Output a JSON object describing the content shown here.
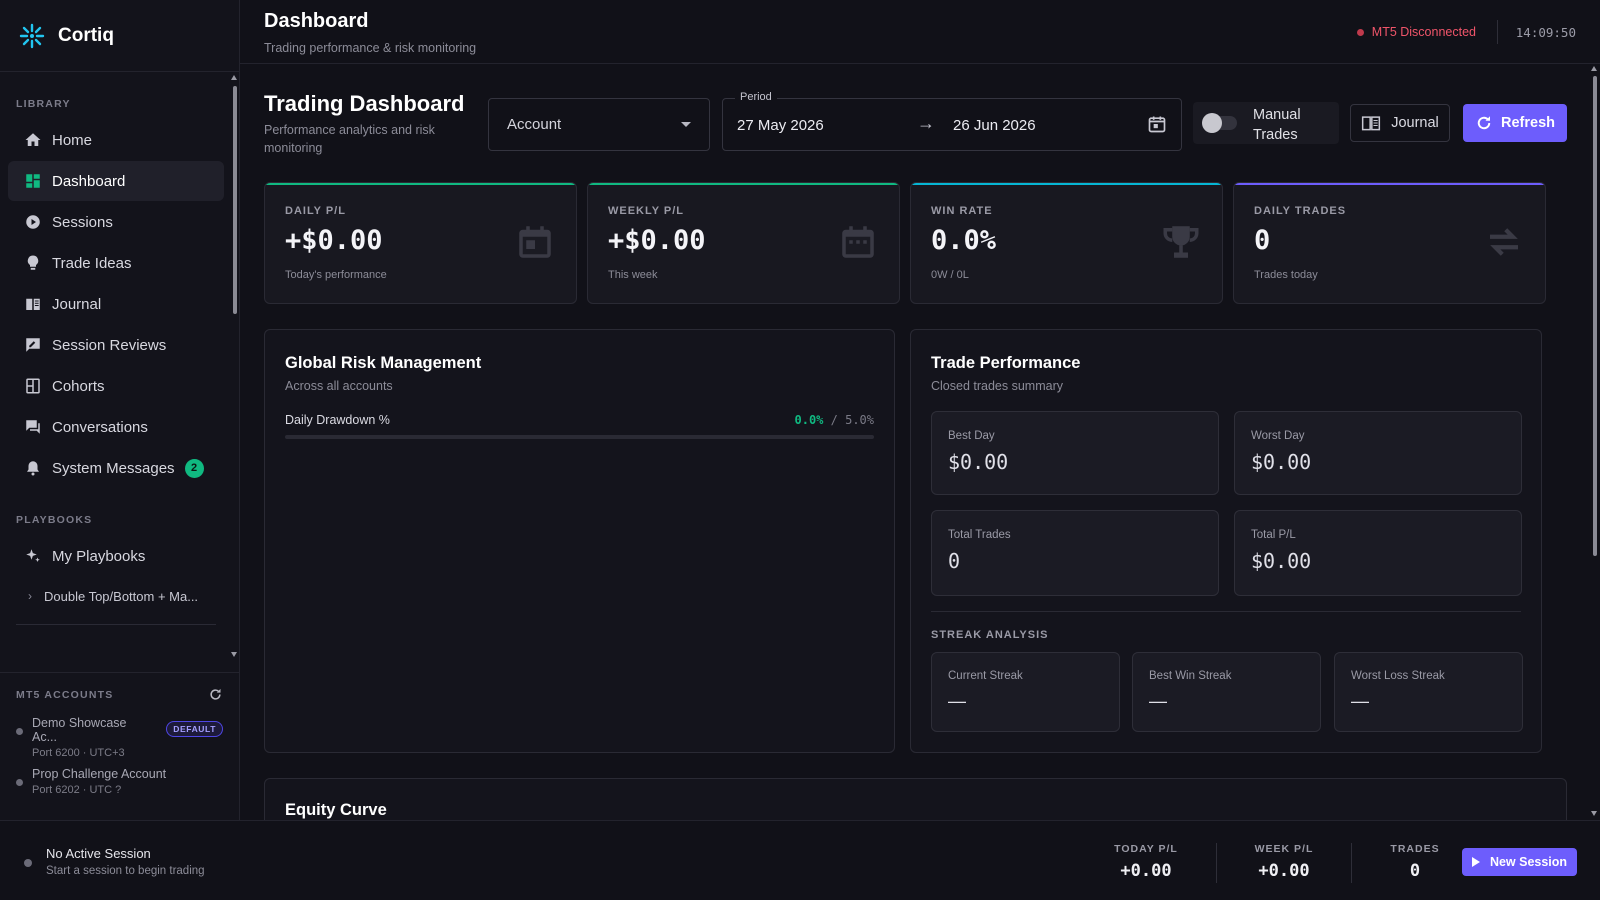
{
  "app": {
    "name": "Cortiq"
  },
  "topbar": {
    "title": "Dashboard",
    "subtitle": "Trading performance & risk monitoring",
    "status": "MT5 Disconnected",
    "clock": "14:09:50"
  },
  "sidebar": {
    "library_label": "LIBRARY",
    "items": [
      {
        "label": "Home",
        "icon": "home-icon"
      },
      {
        "label": "Dashboard",
        "icon": "dashboard-icon"
      },
      {
        "label": "Sessions",
        "icon": "play-circle-icon"
      },
      {
        "label": "Trade Ideas",
        "icon": "lightbulb-icon"
      },
      {
        "label": "Journal",
        "icon": "book-icon"
      },
      {
        "label": "Session Reviews",
        "icon": "rate-review-icon"
      },
      {
        "label": "Cohorts",
        "icon": "cohorts-icon"
      },
      {
        "label": "Conversations",
        "icon": "chat-icon"
      },
      {
        "label": "System Messages",
        "icon": "bell-icon",
        "badge": "2"
      }
    ],
    "playbooks_label": "PLAYBOOKS",
    "my_playbooks": "My Playbooks",
    "playbook_item": "Double Top/Bottom + Ma...",
    "mt5": {
      "label": "MT5 ACCOUNTS",
      "accounts": [
        {
          "name": "Demo Showcase Ac...",
          "meta": "Port 6200 · UTC+3",
          "badge": "DEFAULT"
        },
        {
          "name": "Prop Challenge Account",
          "meta": "Port 6202 · UTC ?"
        }
      ]
    }
  },
  "header": {
    "title": "Trading Dashboard",
    "subtitle": "Performance analytics and risk monitoring",
    "account_select": "Account",
    "period_label": "Period",
    "period_start": "27 May 2026",
    "period_arrow": "→",
    "period_end": "26 Jun 2026",
    "manual_trades": "Manual Trades",
    "journal_button": "Journal",
    "refresh_button": "Refresh"
  },
  "stats": [
    {
      "label": "DAILY P/L",
      "value": "+$0.00",
      "note": "Today's performance",
      "accent": "#10b981",
      "icon": "calendar-icon"
    },
    {
      "label": "WEEKLY P/L",
      "value": "+$0.00",
      "note": "This week",
      "accent": "#10b981",
      "icon": "calendar-week-icon"
    },
    {
      "label": "WIN RATE",
      "value": "0.0%",
      "note": "0W / 0L",
      "accent": "#06b6d4",
      "icon": "trophy-icon"
    },
    {
      "label": "DAILY TRADES",
      "value": "0",
      "note": "Trades today",
      "accent": "#6d5dfc",
      "icon": "swap-icon"
    }
  ],
  "risk": {
    "title": "Global Risk Management",
    "subtitle": "Across all accounts",
    "drawdown_label": "Daily Drawdown %",
    "drawdown_value": "0.0%",
    "drawdown_separator": " / ",
    "drawdown_limit": "5.0%",
    "drawdown_fraction": 0
  },
  "performance": {
    "title": "Trade Performance",
    "subtitle": "Closed trades summary",
    "boxes": [
      {
        "label": "Best Day",
        "value": "$0.00"
      },
      {
        "label": "Worst Day",
        "value": "$0.00"
      },
      {
        "label": "Total Trades",
        "value": "0"
      },
      {
        "label": "Total P/L",
        "value": "$0.00"
      }
    ],
    "streak_label": "STREAK ANALYSIS",
    "streaks": [
      {
        "label": "Current Streak",
        "value": "—"
      },
      {
        "label": "Best Win Streak",
        "value": "—"
      },
      {
        "label": "Worst Loss Streak",
        "value": "—"
      }
    ]
  },
  "equity": {
    "title": "Equity Curve"
  },
  "footer": {
    "session_title": "No Active Session",
    "session_sub": "Start a session to begin trading",
    "today_label": "TODAY P/L",
    "today_value": "+0.00",
    "week_label": "WEEK P/L",
    "week_value": "+0.00",
    "trades_label": "TRADES",
    "trades_value": "0",
    "new_session": "New Session"
  },
  "colors": {
    "accent": "#6d5dfc",
    "positive": "#10b981",
    "danger": "#f0556a",
    "background": "#111118"
  }
}
